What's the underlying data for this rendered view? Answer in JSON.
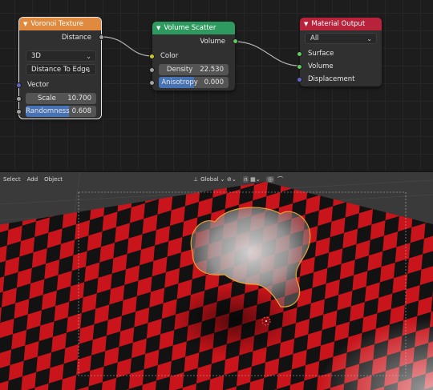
{
  "nodes": {
    "voronoi": {
      "title": "Voronoi Texture",
      "output_distance": "Distance",
      "dimension": "3D",
      "feature": "Distance To Edge",
      "input_vector": "Vector",
      "scale_label": "Scale",
      "scale_value": "10.700",
      "randomness_label": "Randomness",
      "randomness_value": "0.608",
      "randomness_fraction": 0.608,
      "header_color": "#e08a3f"
    },
    "volume_scatter": {
      "title": "Volume Scatter",
      "output_volume": "Volume",
      "input_color": "Color",
      "density_label": "Density",
      "density_value": "22.530",
      "anisotropy_label": "Anisotropy",
      "anisotropy_value": "0.000",
      "header_color": "#2f9a5f"
    },
    "material_output": {
      "title": "Material Output",
      "target": "All",
      "input_surface": "Surface",
      "input_volume": "Volume",
      "input_displacement": "Displacement",
      "header_color": "#b8233b"
    }
  },
  "viewport": {
    "menu": [
      "Select",
      "Add",
      "Object"
    ],
    "transform_orientation": "Global",
    "checker_colors": [
      "#c8141a",
      "#121212"
    ]
  }
}
